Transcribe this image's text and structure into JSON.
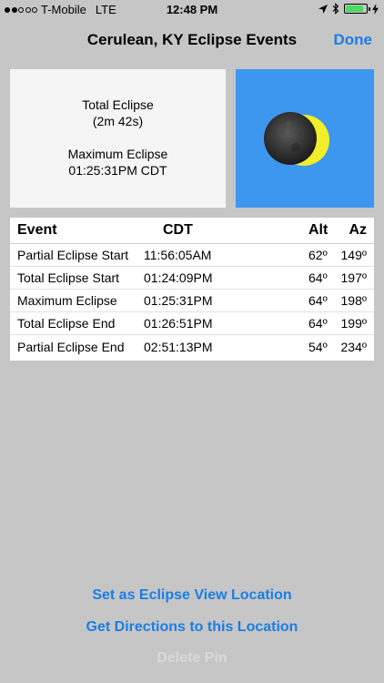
{
  "status_bar": {
    "carrier": "T-Mobile",
    "network": "LTE",
    "time": "12:48 PM",
    "signal_bars": 2,
    "signal_total": 5,
    "battery_level": 0.85
  },
  "nav": {
    "title": "Cerulean, KY Eclipse Events",
    "done_label": "Done"
  },
  "summary": {
    "line1": "Total Eclipse",
    "line2": "(2m 42s)",
    "line3": "Maximum Eclipse",
    "line4": "01:25:31PM CDT"
  },
  "table": {
    "headers": {
      "event": "Event",
      "time": "CDT",
      "alt": "Alt",
      "az": "Az"
    },
    "rows": [
      {
        "event": "Partial Eclipse Start",
        "time": "11:56:05AM",
        "alt": "62º",
        "az": "149º"
      },
      {
        "event": "Total Eclipse Start",
        "time": "01:24:09PM",
        "alt": "64º",
        "az": "197º"
      },
      {
        "event": "Maximum Eclipse",
        "time": "01:25:31PM",
        "alt": "64º",
        "az": "198º"
      },
      {
        "event": "Total Eclipse End",
        "time": "01:26:51PM",
        "alt": "64º",
        "az": "199º"
      },
      {
        "event": "Partial Eclipse End",
        "time": "02:51:13PM",
        "alt": "54º",
        "az": "234º"
      }
    ]
  },
  "actions": {
    "set_location": "Set as Eclipse View Location",
    "get_directions": "Get Directions to this Location",
    "delete_pin": "Delete Pin"
  },
  "colors": {
    "accent": "#1a7ee6",
    "eclipse_bg": "#3e97ef",
    "sun": "#f2ee2a",
    "moon": "#2a2a2a"
  },
  "icons": [
    "location-arrow-icon",
    "bluetooth-icon",
    "battery-icon",
    "charging-bolt-icon"
  ]
}
